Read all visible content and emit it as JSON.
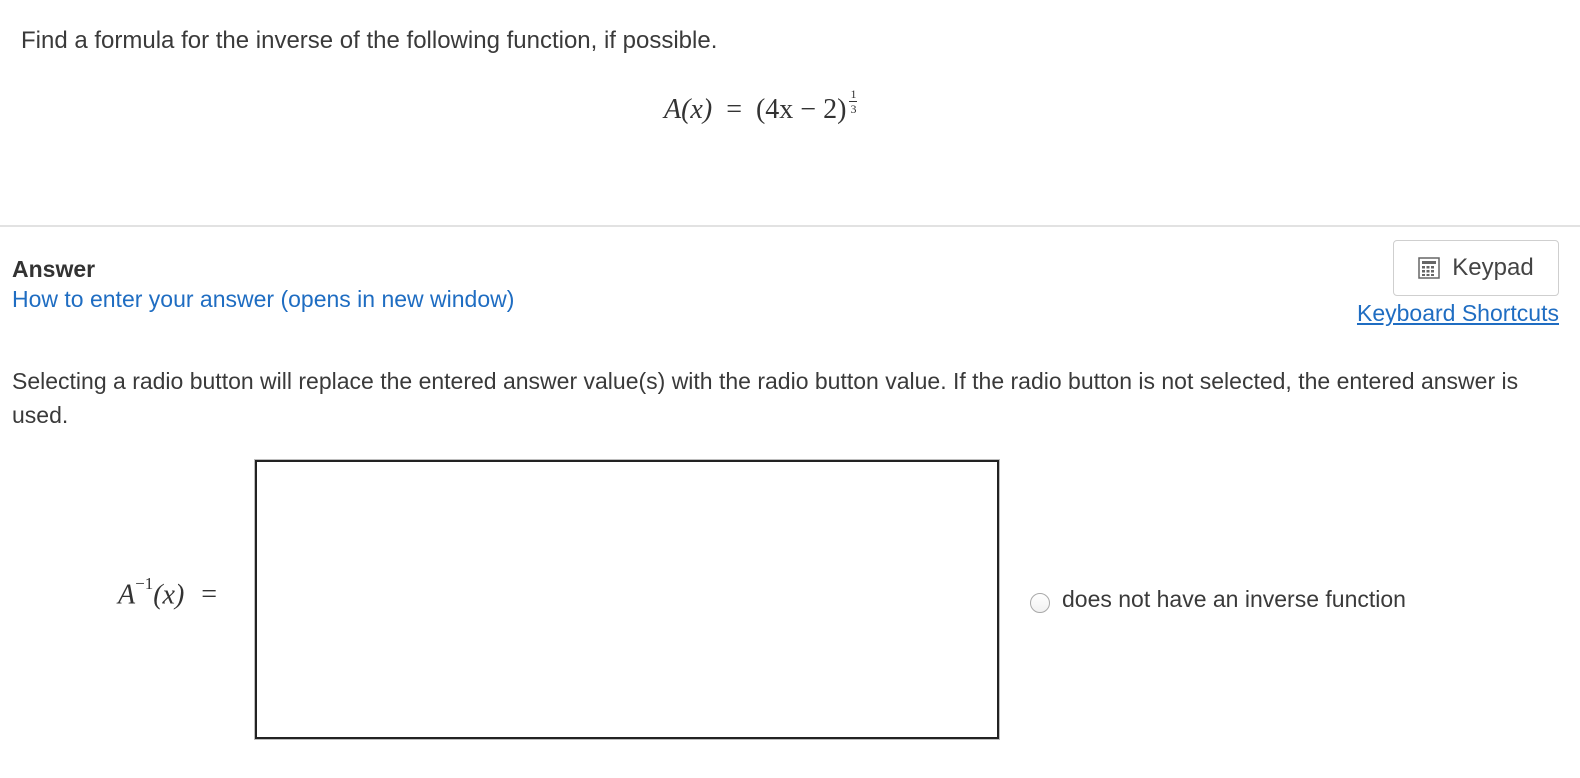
{
  "question": {
    "prompt": "Find a formula for the inverse of the following function, if possible.",
    "formula": {
      "lhs": "A(x)",
      "equals": "=",
      "base": "(4x − 2)",
      "exponent_numerator": "1",
      "exponent_denominator": "3"
    }
  },
  "answer_section": {
    "heading": "Answer",
    "help_link": "How to enter your answer (opens in new window)",
    "keypad_button": "Keypad",
    "keypad_icon": "calculator-icon",
    "shortcuts_link": "Keyboard Shortcuts",
    "instructions": "Selecting a radio button will replace the entered answer value(s) with the radio button value. If the radio button is not selected, the entered answer is used.",
    "input_label": {
      "base": "A",
      "superscript": "−1",
      "argument": "(x)",
      "equals": "="
    },
    "input_value": "",
    "radio_option": {
      "label": "does not have an inverse function",
      "selected": false
    }
  },
  "colors": {
    "link": "#1f6dc2",
    "text": "#3a3a3a",
    "divider": "#e2e2e2"
  }
}
